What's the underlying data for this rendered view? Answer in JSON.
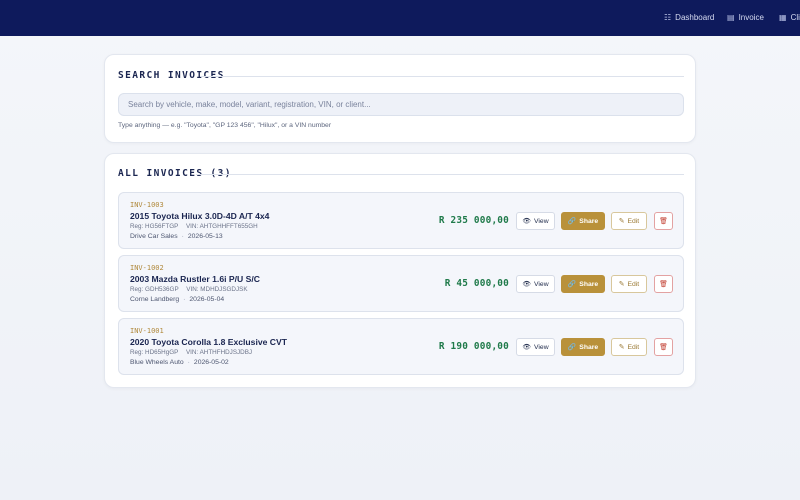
{
  "nav": {
    "items": [
      {
        "icon": "dashboard-icon",
        "glyph": "☷",
        "label": "Dashboard"
      },
      {
        "icon": "invoice-icon",
        "glyph": "▤",
        "label": "Invoice"
      },
      {
        "icon": "clients-icon",
        "glyph": "▦",
        "label": "Cli"
      }
    ]
  },
  "search": {
    "title": "SEARCH INVOICES",
    "placeholder": "Search by vehicle, make, model, variant, registration, VIN, or client...",
    "value": "",
    "hint": "Type anything — e.g. \"Toyota\", \"GP 123 456\", \"Hilux\", or a VIN number"
  },
  "list": {
    "title": "ALL INVOICES (3)",
    "buttons": {
      "view": "View",
      "share": "Share",
      "edit": "Edit",
      "view_icon": "eye-icon",
      "share_icon": "link-icon",
      "edit_icon": "pencil-icon",
      "delete_icon": "trash-icon"
    },
    "invoices": [
      {
        "id": "INV-1003",
        "title": "2015 Toyota Hilux 3.0D-4D A/T 4x4",
        "reg": "Reg: HG56FTGP",
        "vin": "VIN: AHTGHHFFT655GH",
        "client": "Drive Car Sales",
        "date": "2026-05-13",
        "amount": "R 235 000,00"
      },
      {
        "id": "INV-1002",
        "title": "2003 Mazda Rustler 1.6i P/U S/C",
        "reg": "Reg: GDH536GP",
        "vin": "VIN: MDHDJSGDJSK",
        "client": "Corne Landberg",
        "date": "2026-05-04",
        "amount": "R 45 000,00"
      },
      {
        "id": "INV-1001",
        "title": "2020 Toyota Corolla 1.8 Exclusive CVT",
        "reg": "Reg: HD65HgGP",
        "vin": "VIN: AHTHFHDJSJDBJ",
        "client": "Blue Wheels Auto",
        "date": "2026-05-02",
        "amount": "R 190 000,00"
      }
    ]
  },
  "colors": {
    "topbar": "#0e1a5c",
    "accent_gold": "#b9913a",
    "amount_green": "#1f7a4a",
    "danger": "#c0392b"
  }
}
